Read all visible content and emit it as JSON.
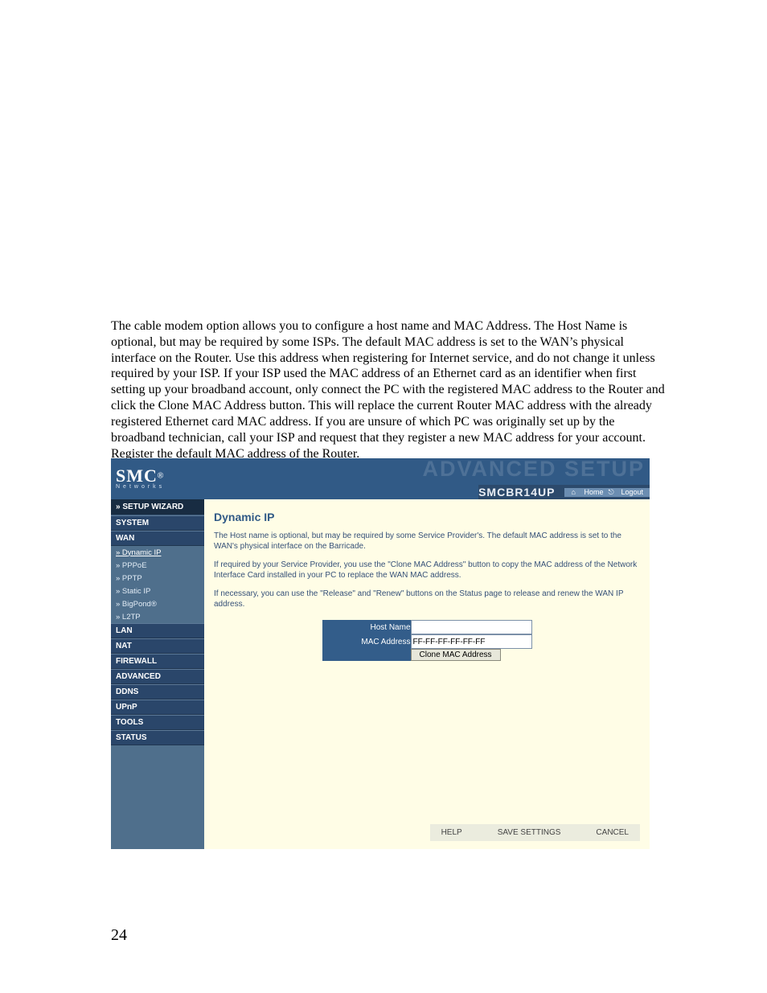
{
  "pageNumber": "24",
  "doc": {
    "paragraph": "The cable modem option allows you to configure a host name and MAC Address. The Host Name is optional, but may be required by some ISPs. The default MAC address is set to the WAN’s physical interface on the Router. Use this address when registering for Internet service, and do not change it unless required by your ISP. If your ISP used the MAC address of an Ethernet card as an identifier when first setting up your broadband account, only connect the PC with the registered MAC address to the Router and click the Clone MAC Address button. This will replace the current Router MAC address with the already registered Ethernet card MAC address. If you are unsure of which PC was originally set up by the broadband technician, call your ISP and request that they register a new MAC address for your account. Register the default MAC address of the Router."
  },
  "router": {
    "logo": {
      "brand": "SMC",
      "reg": "®",
      "sub": "Networks"
    },
    "banner": {
      "ghost": "ADVANCED SETUP",
      "model": "SMCBR14UP",
      "home": "Home",
      "logout": "Logout"
    },
    "sidebar": {
      "wizard": "» SETUP WIZARD",
      "cats": {
        "system": "SYSTEM",
        "wan": "WAN",
        "lan": "LAN",
        "nat": "NAT",
        "firewall": "FIREWALL",
        "advanced": "ADVANCED",
        "ddns": "DDNS",
        "upnp": "UPnP",
        "tools": "TOOLS",
        "status": "STATUS"
      },
      "wanSubs": {
        "dynip": "» Dynamic IP",
        "pppoe": "» PPPoE",
        "pptp": "» PPTP",
        "static": "» Static IP",
        "bigpond": "» BigPond®",
        "l2tp": "» L2TP"
      }
    },
    "main": {
      "title": "Dynamic IP",
      "p1": "The Host name is optional, but may be required by some Service Provider's. The default MAC address is set to the WAN's physical interface on the Barricade.",
      "p2": "If required by your Service Provider, you use the \"Clone MAC Address\" button to copy the MAC address of the Network Interface Card installed in your PC to replace the WAN MAC address.",
      "p3": "If necessary, you can use the \"Release\" and \"Renew\" buttons on the Status page to release and renew the WAN IP address.",
      "labels": {
        "host": "Host Name",
        "mac": "MAC Address"
      },
      "values": {
        "host": "",
        "mac": "FF-FF-FF-FF-FF-FF"
      },
      "cloneBtn": "Clone MAC Address"
    },
    "footer": {
      "help": "HELP",
      "save": "SAVE SETTINGS",
      "cancel": "CANCEL"
    }
  }
}
